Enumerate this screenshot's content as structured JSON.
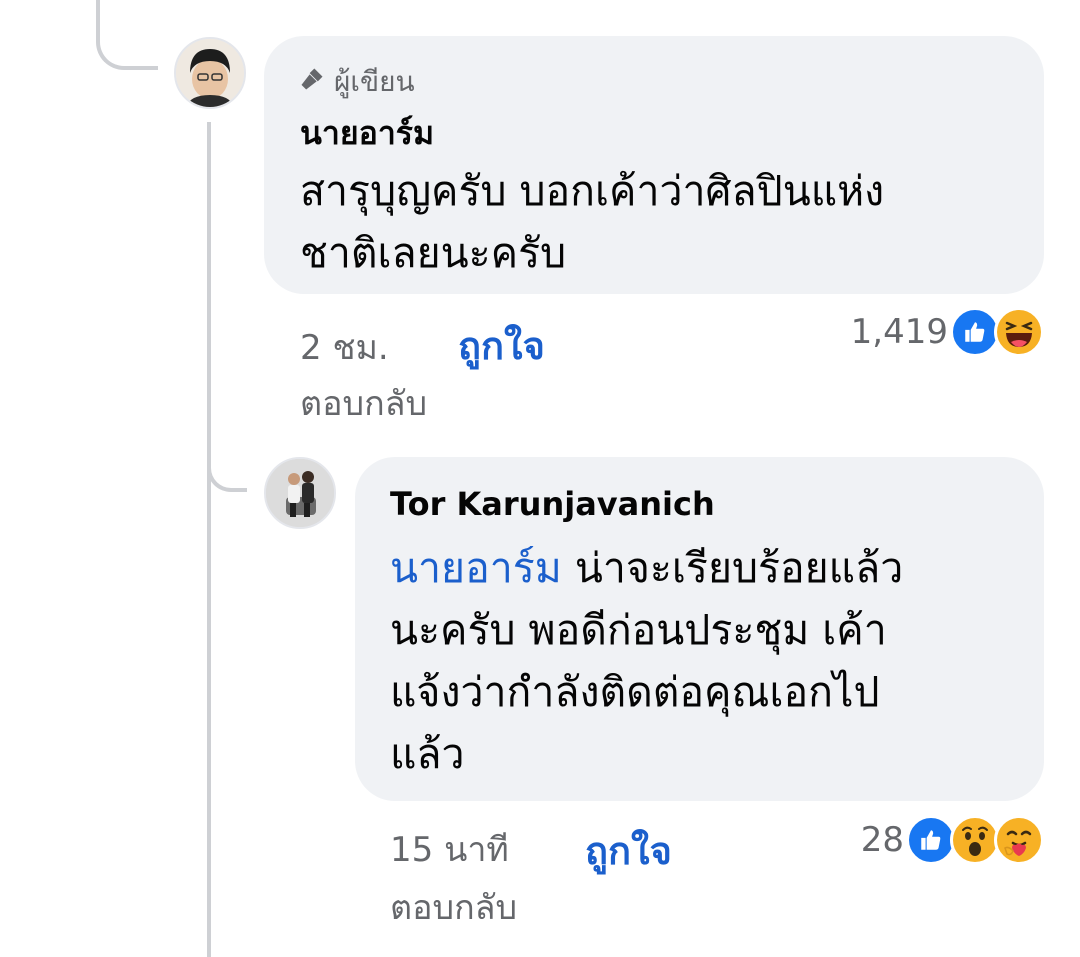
{
  "comment": {
    "author_badge": "ผู้เขียน",
    "author": "นายอาร์ม",
    "text_lines": [
      "สารุบุญครับ บอกเค้าว่าศิลปินแห่ง",
      "ชาติเลยนะครับ"
    ],
    "time": "2 ชม.",
    "like_label": "ถูกใจ",
    "reply_label": "ตอบกลับ",
    "reaction_count": "1,419",
    "reactions": [
      "like-icon",
      "haha-icon"
    ]
  },
  "reply": {
    "author": "Tor Karunjavanich",
    "mention": "นายอาร์ม",
    "first_line_rest": " น่าจะเรียบร้อยแล้ว",
    "text_lines": [
      "นะครับ พอดีก่อนประชุม เค้า",
      "แจ้งว่ากำลังติดต่อคุณเอกไป",
      "แล้ว"
    ],
    "time": "15 นาที",
    "like_label": "ถูกใจ",
    "reply_label": "ตอบกลับ",
    "reaction_count": "28",
    "reactions": [
      "like-icon",
      "wow-icon",
      "care-icon"
    ]
  },
  "colors": {
    "bubble": "#f0f2f5",
    "link": "#1b5fcc",
    "meta": "#65676b",
    "like": "#1877f2",
    "emoji": "#f7b125"
  }
}
